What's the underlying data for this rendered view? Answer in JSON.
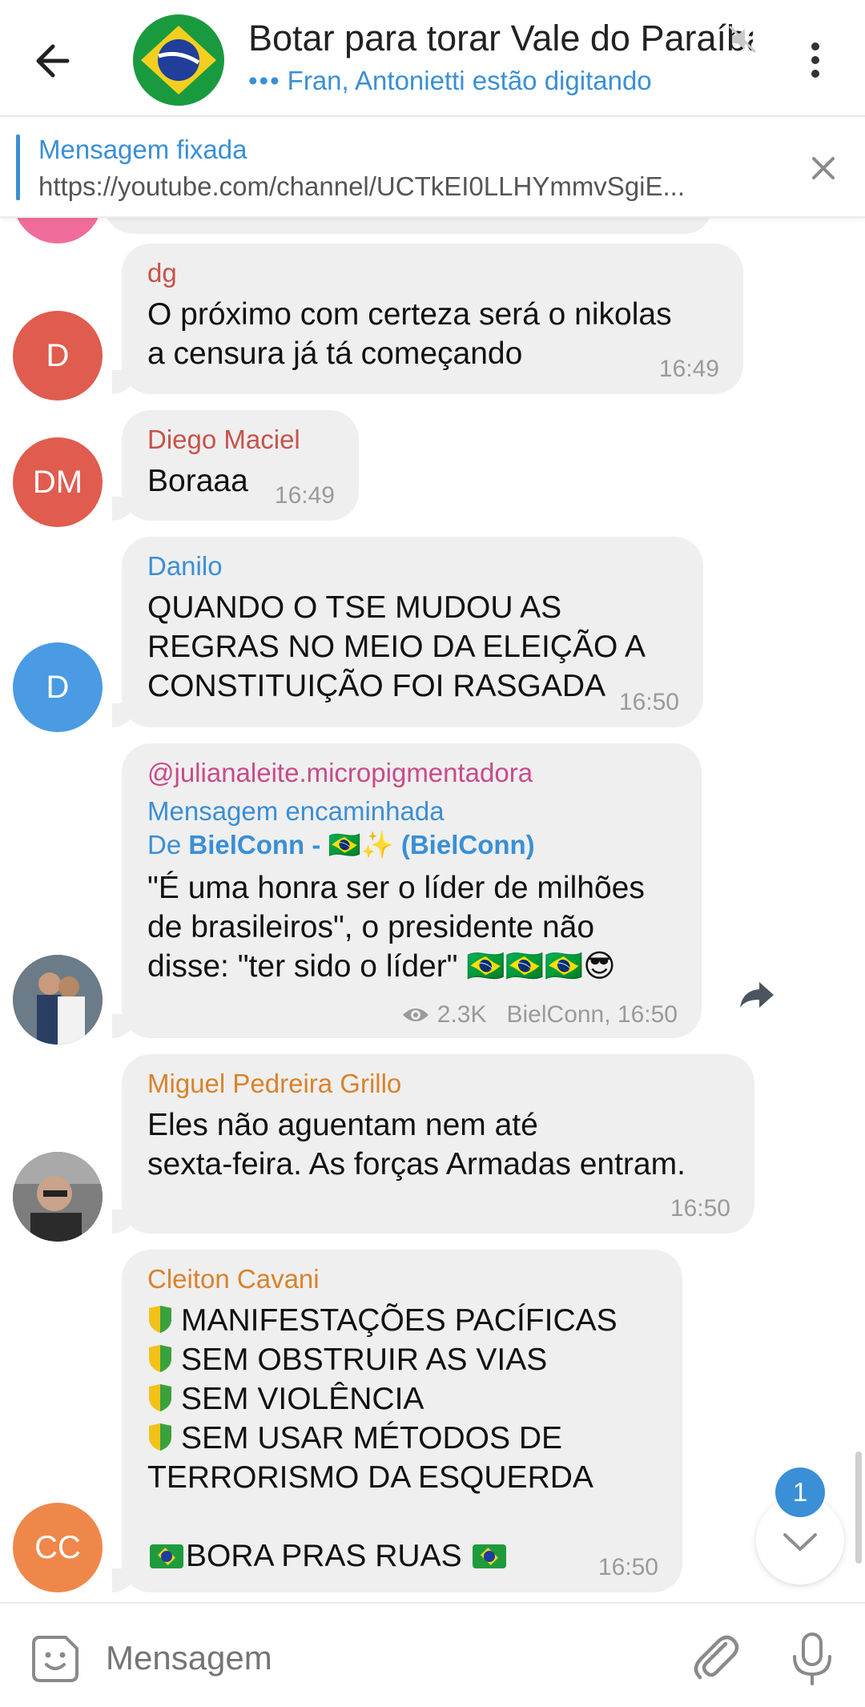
{
  "header": {
    "title": "Botar para torar Vale do Paraíba",
    "typing": "Fran, Antonietti estão digitando",
    "typing_dots": "•••"
  },
  "pinned": {
    "title": "Mensagem fixada",
    "text": "https://youtube.com/channel/UCTkEI0LLHYmmvSgiE..."
  },
  "messages": [
    {
      "sender": "dg",
      "sender_color": "#c8524a",
      "avatar_initials": "D",
      "avatar_color": "#e05c4f",
      "lines": [
        "O próximo com certeza será o nikolas",
        "a censura já tá começando"
      ],
      "time": "16:49"
    },
    {
      "sender": "Diego Maciel",
      "sender_color": "#c8524a",
      "avatar_initials": "DM",
      "avatar_color": "#e05c4f",
      "lines": [
        "Boraaa"
      ],
      "time": "16:49"
    },
    {
      "sender": "Danilo",
      "sender_color": "#3a8fd6",
      "avatar_initials": "D",
      "avatar_color": "#4a9be3",
      "lines": [
        "QUANDO O TSE MUDOU AS",
        "REGRAS NO MEIO DA ELEIÇÃO A",
        "CONSTITUIÇÃO FOI RASGADA"
      ],
      "time": "16:50"
    },
    {
      "sender": "@julianaleite.micropigmentadora",
      "sender_color": "#c94a8a",
      "forwarded_label": "Mensagem encaminhada",
      "forwarded_from_prefix": "De",
      "forwarded_from_name": "BielConn - 🇧🇷✨ (BielConn)",
      "lines": [
        "\"É uma honra ser o líder de milhões",
        "de brasileiros\", o presidente não",
        "disse: \"ter sido o líder\" 🇧🇷🇧🇷🇧🇷😎"
      ],
      "views": "2.3K",
      "signature_time": "BielConn, 16:50"
    },
    {
      "sender": "Miguel Pedreira Grillo",
      "sender_color": "#d9822b",
      "lines": [
        "Eles não aguentam nem até",
        "sexta-feira. As forças Armadas entram."
      ],
      "time": "16:50"
    },
    {
      "sender": "Cleiton Cavani",
      "sender_color": "#d9822b",
      "avatar_initials": "CC",
      "avatar_color": "#f0874a",
      "lines": [
        "MANIFESTAÇÕES PACÍFICAS",
        "SEM OBSTRUIR AS VIAS",
        "SEM VIOLÊNCIA",
        "SEM USAR MÉTODOS DE",
        "TERRORISMO DA ESQUERDA",
        "BORA PRAS RUAS"
      ],
      "time": "16:50"
    }
  ],
  "unread_badge": "1",
  "input": {
    "placeholder": "Mensagem"
  },
  "icons": {
    "back": "arrow-left-icon",
    "mute": "muted-speaker-icon",
    "menu": "kebab-menu-icon",
    "close": "close-icon",
    "forward": "share-arrow-icon",
    "views": "eye-icon",
    "scroll_down": "chevron-down-icon",
    "emoji": "sticker-emoji-icon",
    "attach": "paperclip-icon",
    "mic": "microphone-icon"
  }
}
